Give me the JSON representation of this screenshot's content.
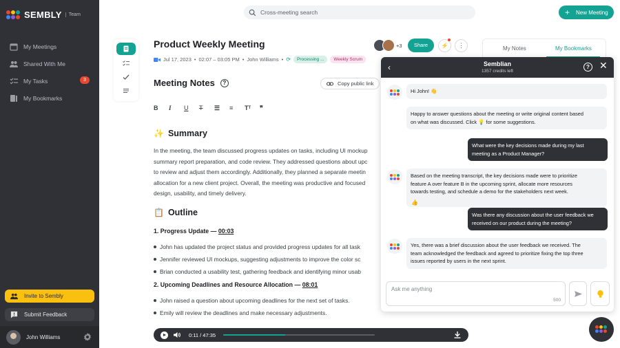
{
  "app": {
    "logo_text": "SEMBLY",
    "logo_sub": "Team",
    "brand_colors": {
      "teal": "#14a392",
      "yellow": "#f9c00f",
      "dark": "#2f3136",
      "red": "#e8482f"
    }
  },
  "sidebar": {
    "items": [
      {
        "label": "My Meetings",
        "icon": "calendar-icon"
      },
      {
        "label": "Shared With Me",
        "icon": "people-icon"
      },
      {
        "label": "My Tasks",
        "icon": "tasks-icon",
        "badge": "3"
      },
      {
        "label": "My Bookmarks",
        "icon": "bookmark-icon"
      }
    ],
    "invite_label": "Invite to Sembly",
    "feedback_label": "Submit Feedback",
    "user_name": "John Williams"
  },
  "topbar": {
    "search_placeholder": "Cross-meeting search",
    "new_meeting_label": "New Meeting"
  },
  "meeting": {
    "title": "Product Weekly Meeting",
    "date": "Jul 17, 2023",
    "time": "02:07 – 03:05 PM",
    "owner": "John Williams",
    "status_chip": "Processing ...",
    "tag_chip": "Weekly Scrum",
    "participants_more": "+3",
    "share_label": "Share"
  },
  "notes": {
    "heading": "Meeting Notes",
    "copy_link_label": "Copy public link",
    "summary_heading": "Summary",
    "summary_lines": [
      "In the meeting, the team discussed progress updates on tasks, including UI mockup",
      "summary report preparation, and code review. They addressed questions about upc",
      "to review and adjust them accordingly. Additionally, they planned a separate meetin",
      "allocation for a new client project. Overall, the meeting was productive and focused",
      "design, usability, and timely delivery."
    ],
    "outline_heading": "Outline",
    "sections": [
      {
        "title": "1. Progress Update — ",
        "timestamp": "00:03",
        "bullets": [
          "John has updated the project status and provided progress updates for all task",
          "Jennifer reviewed UI mockups, suggesting adjustments to improve the color sc",
          "Brian conducted a usability test, gathering feedback and identifying minor usab"
        ]
      },
      {
        "title": "2. Upcoming Deadlines and Resource Allocation — ",
        "timestamp": "08:01",
        "bullets": [
          "John raised a question about upcoming deadlines for the next set of tasks.",
          "Emily will review the deadlines and make necessary adjustments."
        ]
      }
    ]
  },
  "player": {
    "time": "0:11 / 47:35",
    "progress_fraction": 0.41
  },
  "right_panel": {
    "tabs": [
      "My Notes",
      "My Bookmarks"
    ],
    "active_tab": "My Bookmarks"
  },
  "chat": {
    "title": "Semblian",
    "credits": "1357 credits left",
    "messages": [
      {
        "from": "bot",
        "lines": [
          "Hi John! 👋"
        ]
      },
      {
        "from": "bot",
        "lines": [
          "Happy to answer questions about the meeting or write original content based",
          "on what was discussed. Click 💡 for some suggestions."
        ]
      },
      {
        "from": "user",
        "lines": [
          "What were the key decisions made during my last",
          "meeting as a Product Manager?"
        ]
      },
      {
        "from": "bot",
        "lines": [
          "Based on the meeting transcript, the key decisions made were to prioritize",
          "feature A over feature B in the upcoming sprint, allocate more resources",
          "towards testing, and schedule a demo for the stakeholders next week."
        ]
      },
      {
        "from": "user",
        "lines": [
          "Was there any discussion about the user feedback we",
          "received on our product during the meeting?"
        ]
      },
      {
        "from": "bot",
        "lines": [
          "Yes, there was a brief discussion about the user feedback we received. The",
          "team acknowledged the feedback and agreed to prioritize fixing the top three",
          "issues reported by users in the next sprint."
        ]
      }
    ],
    "input_placeholder": "Ask me anything",
    "char_limit": "500"
  }
}
